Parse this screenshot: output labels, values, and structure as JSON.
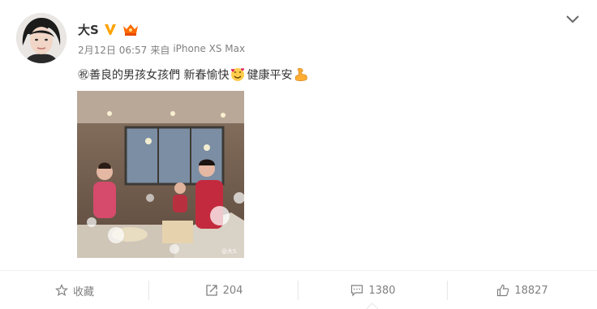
{
  "post": {
    "username": "大S",
    "meta": {
      "date": "2月12日 06:57",
      "source_prefix": "来自",
      "source": "iPhone XS Max"
    },
    "text": {
      "part1": "㊗善良的男孩女孩們 新春愉快",
      "part2": "健康平安"
    },
    "photo_watermark": "@大S"
  },
  "icons": {
    "verified": "verified-v-badge",
    "vip": "vip-crown-badge",
    "menu": "chevron-down-icon",
    "emoji_smile": "smiling-face-with-hearts-emoji",
    "emoji_muscle": "flexed-biceps-emoji",
    "favorite": "star-icon",
    "repost": "share-arrow-icon",
    "comment": "comment-icon",
    "like": "thumbs-up-icon"
  },
  "actions": {
    "favorite_label": "收藏",
    "repost_count": "204",
    "comment_count": "1380",
    "like_count": "18827"
  },
  "colors": {
    "accent": "#ff8200",
    "verified": "#ffa200",
    "text": "#333333",
    "muted": "#808080"
  }
}
